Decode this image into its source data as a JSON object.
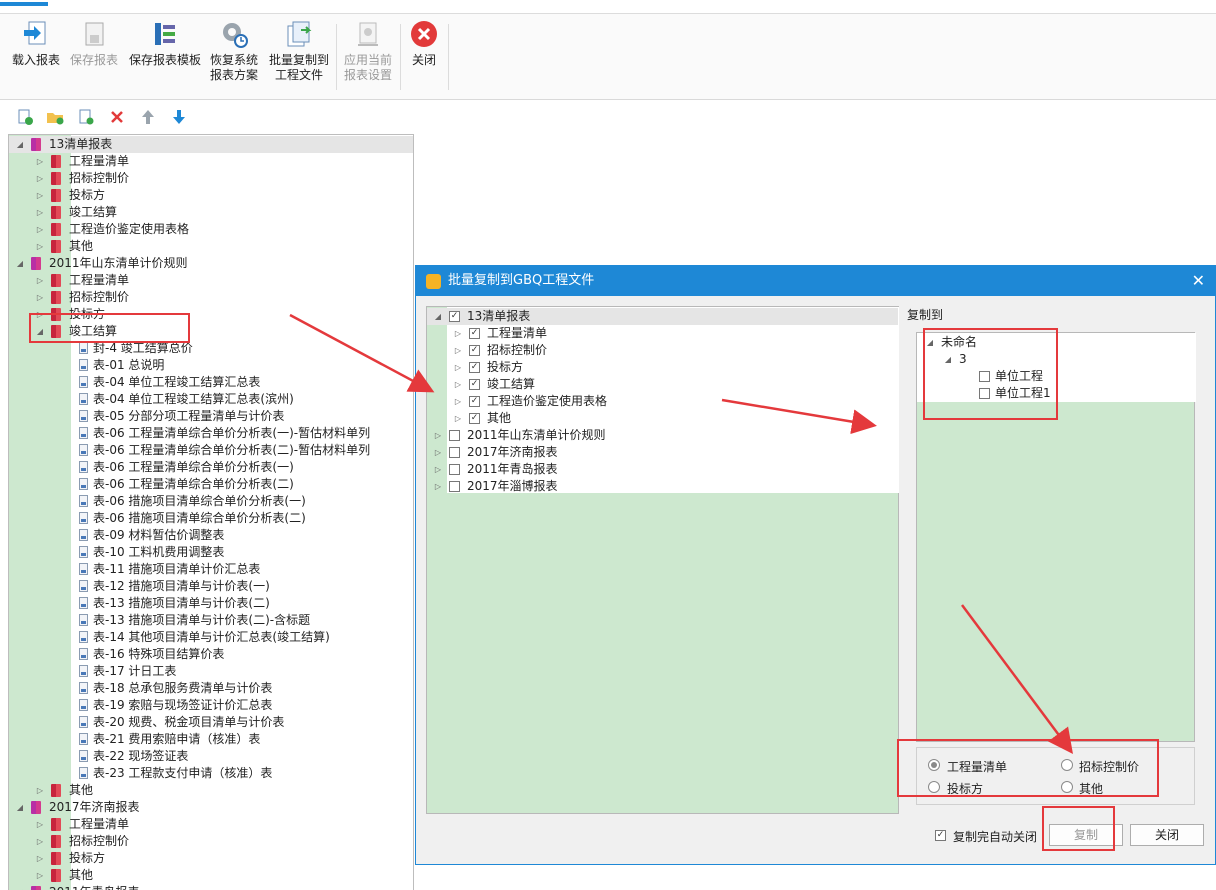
{
  "ribbon": {
    "buttons": [
      {
        "label1": "载入报表",
        "label2": "",
        "disabled": false,
        "icon": "load-report-icon"
      },
      {
        "label1": "保存报表",
        "label2": "",
        "disabled": true,
        "icon": "save-report-icon"
      },
      {
        "label1": "保存报表模板",
        "label2": "",
        "disabled": false,
        "icon": "save-template-icon"
      },
      {
        "label1": "恢复系统",
        "label2": "报表方案",
        "disabled": false,
        "icon": "restore-gear-icon"
      },
      {
        "label1": "批量复制到",
        "label2": "工程文件",
        "disabled": false,
        "icon": "batch-copy-icon"
      },
      {
        "label1": "应用当前",
        "label2": "报表设置",
        "disabled": true,
        "icon": "apply-settings-icon"
      },
      {
        "label1": "关闭",
        "label2": "",
        "disabled": false,
        "icon": "close-red-icon"
      }
    ]
  },
  "left_toolbar": [
    "new-report-icon",
    "new-folder-icon",
    "new-page-icon",
    "delete-icon",
    "move-up-icon",
    "move-down-icon"
  ],
  "left_tree": {
    "root1": "13清单报表",
    "root1_children": [
      "工程量清单",
      "招标控制价",
      "投标方",
      "竣工结算",
      "工程造价鉴定使用表格",
      "其他"
    ],
    "root2": "2011年山东清单计价规则",
    "root2_children_before": [
      "工程量清单",
      "招标控制价",
      "投标方"
    ],
    "root2_open": "竣工结算",
    "reports": [
      "封-4 竣工结算总价",
      "表-01 总说明",
      "表-04 单位工程竣工结算汇总表",
      "表-04 单位工程竣工结算汇总表(滨州)",
      "表-05 分部分项工程量清单与计价表",
      "表-06 工程量清单综合单价分析表(一)-暂估材料单列",
      "表-06 工程量清单综合单价分析表(二)-暂估材料单列",
      "表-06 工程量清单综合单价分析表(一)",
      "表-06 工程量清单综合单价分析表(二)",
      "表-06 措施项目清单综合单价分析表(一)",
      "表-06 措施项目清单综合单价分析表(二)",
      "表-09 材料暂估价调整表",
      "表-10 工料机费用调整表",
      "表-11 措施项目清单计价汇总表",
      "表-12 措施项目清单与计价表(一)",
      "表-13 措施项目清单与计价表(二)",
      "表-13 措施项目清单与计价表(二)-含标题",
      "表-14 其他项目清单与计价汇总表(竣工结算)",
      "表-16 特殊项目结算价表",
      "表-17 计日工表",
      "表-18 总承包服务费清单与计价表",
      "表-19 索赔与现场签证计价汇总表",
      "表-20 规费、税金项目清单与计价表",
      "表-21 费用索赔申请（核准）表",
      "表-22 现场签证表",
      "表-23 工程款支付申请（核准）表"
    ],
    "root2_after": "其他",
    "root3": "2017年济南报表",
    "root3_children": [
      "工程量清单",
      "招标控制价",
      "投标方",
      "其他"
    ],
    "root4_partial": "2011年青岛报表"
  },
  "dialog": {
    "title": "批量复制到GBQ工程文件",
    "close_glyph": "✕",
    "source_tree": {
      "root": "13清单报表",
      "children": [
        "工程量清单",
        "招标控制价",
        "投标方",
        "竣工结算",
        "工程造价鉴定使用表格",
        "其他"
      ],
      "others": [
        "2011年山东清单计价规则",
        "2017年济南报表",
        "2011年青岛报表",
        "2017年淄博报表"
      ]
    },
    "copy_to_label": "复制到",
    "target_tree": {
      "root": "未命名",
      "node": "3",
      "units": [
        "单位工程",
        "单位工程1"
      ]
    },
    "radios": [
      {
        "label": "工程量清单",
        "checked": true
      },
      {
        "label": "招标控制价",
        "checked": false
      },
      {
        "label": "投标方",
        "checked": false
      },
      {
        "label": "其他",
        "checked": false
      }
    ],
    "auto_close_label": "复制完自动关闭",
    "copy_button": "复制",
    "close_button": "关闭"
  },
  "colors": {
    "accent": "#1e88d6",
    "tree_green": "#cde8cf",
    "annotation_red": "#e4393c"
  }
}
